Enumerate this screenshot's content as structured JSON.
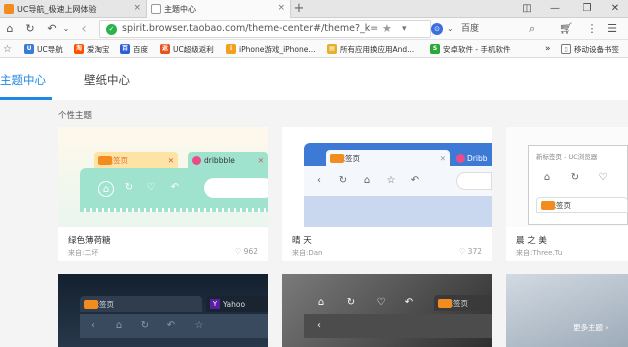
{
  "browser": {
    "tabs": [
      {
        "title": "UC导航_极速上网体验",
        "close": "×"
      },
      {
        "title": "主题中心",
        "close": "×"
      }
    ],
    "new_tab": "+",
    "window": {
      "menu": "☰",
      "minimize": "—",
      "restore": "❐",
      "close": "✕"
    },
    "toolbar": {
      "home": "⌂",
      "refresh": "↻",
      "undo": "↶",
      "back": "‹"
    },
    "url": "spirit.browser.taobao.com/theme-center#/theme?_k=de",
    "search_engine": "百度",
    "bookmarks": [
      {
        "label": "UC导航",
        "icon": "uc-icon",
        "color": "#3a7bd5"
      },
      {
        "label": "爱淘宝",
        "icon": "taobao-icon",
        "color": "#ff5000"
      },
      {
        "label": "百度",
        "icon": "baidu-icon",
        "color": "#2e5fd9"
      },
      {
        "label": "UC超级返利",
        "icon": "uc-rebate-icon",
        "color": "#e8541e"
      },
      {
        "label": "iPhone游戏_iPhone...",
        "icon": "apple-icon",
        "color": "#f2a11f"
      },
      {
        "label": "所有应用换应用And...",
        "icon": "folder-icon",
        "color": "#e6b02a"
      },
      {
        "label": "安卓软件 - 手机软件",
        "icon": "android-icon",
        "color": "#2aa838"
      }
    ],
    "bookmarks_more": "»",
    "bookmarks_device": "移动设备书签"
  },
  "page": {
    "tabs": [
      {
        "label": "主题中心",
        "active": true
      },
      {
        "label": "壁纸中心",
        "active": false
      }
    ],
    "section_title": "个性主题",
    "cards": [
      {
        "name": "绿色薄荷糖",
        "source": "来自:二坏",
        "likes": "962",
        "preview_tab": "新标签页",
        "preview_tab2": "dribbble"
      },
      {
        "name": "晴 天",
        "source": "来自:Dan",
        "likes": "372",
        "preview_tab": "新标签页",
        "preview_tab2": "Dribb"
      },
      {
        "name": "晨 之 美",
        "source": "来自:Three.Tu",
        "likes": "",
        "preview_tab": "新标签页",
        "preview_tab2": "新标签页 - UC浏览器"
      },
      {
        "preview_tab": "新标签页",
        "preview_tab2": "Yahoo"
      },
      {
        "preview_tab": "新标签页"
      }
    ],
    "more_label": "更多主题 ›"
  },
  "colors": {
    "accent": "#1e88e5",
    "mint": "#9fe3cf",
    "sky": "#3d7ad6",
    "dark": "#2a3442"
  }
}
